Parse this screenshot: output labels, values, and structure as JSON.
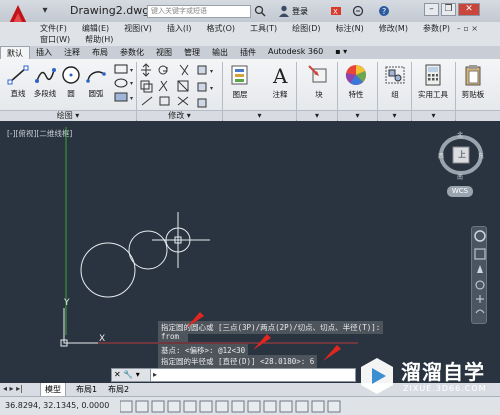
{
  "title_bar": {
    "document_title": "Drawing2.dwg",
    "search_placeholder": "键入关键字或短语",
    "login_label": "登录"
  },
  "menu": {
    "row1": [
      "文件(F)",
      "编辑(E)",
      "视图(V)",
      "插入(I)",
      "格式(O)",
      "工具(T)",
      "绘图(D)",
      "标注(N)",
      "修改(M)",
      "参数(P)"
    ],
    "row2": [
      "窗口(W)",
      "帮助(H)"
    ]
  },
  "ribbon_tabs": [
    "默认",
    "插入",
    "注释",
    "布局",
    "参数化",
    "视图",
    "管理",
    "输出",
    "插件",
    "Autodesk 360",
    "▪ ▾"
  ],
  "ribbon": {
    "draw_tools": [
      "直线",
      "多段线",
      "圆",
      "圆弧"
    ],
    "draw_panel_label": "绘图",
    "modify_panel_label": "修改",
    "big_tools": [
      "图层",
      "注释",
      "块",
      "特性",
      "组",
      "实用工具",
      "剪贴板"
    ]
  },
  "viewport": {
    "label": "[-][俯视][二维线框]",
    "compass": {
      "north": "北",
      "south": "南",
      "west": "西",
      "east": "东",
      "top_label": "上"
    },
    "wcs_label": "WCS",
    "ucs_y": "Y",
    "ucs_x": "X"
  },
  "command_history": {
    "line1": "指定圆的圆心或 [三点(3P)/两点(2P)/切点、切点、半径(T)]:",
    "line2": "from",
    "line3": "基点: <偏移>: @12<30",
    "line4": "指定圆的半径或 [直径(D)] <28.0180>: 6"
  },
  "layout_tabs": [
    "模型",
    "布局1",
    "布局2"
  ],
  "status_bar": {
    "coordinates": "36.8294, 32.1345, 0.0000"
  },
  "watermark": {
    "name": "溜溜自学",
    "url": "ZIXUE.3D66.COM"
  },
  "colors": {
    "canvas": "#2a3440",
    "ribbon": "#eceef1",
    "cmd_overlay": "#50565e",
    "arrow_red": "#e0271f"
  }
}
